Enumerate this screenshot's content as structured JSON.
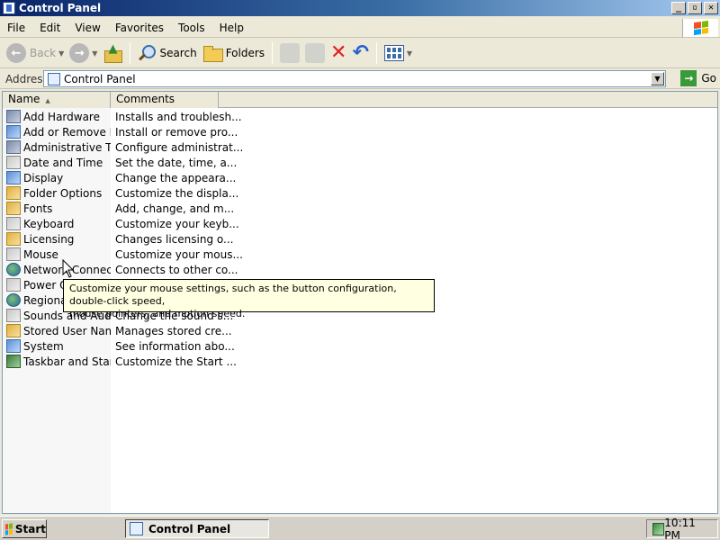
{
  "window": {
    "title": "Control Panel",
    "minimize": "_",
    "maximize": "▫",
    "close": "✕"
  },
  "menu": [
    "File",
    "Edit",
    "View",
    "Favorites",
    "Tools",
    "Help"
  ],
  "toolbar": {
    "back": "Back",
    "search": "Search",
    "folders": "Folders"
  },
  "address": {
    "label": "Address",
    "value": "Control Panel",
    "go": "Go"
  },
  "columns": {
    "name": "Name",
    "comments": "Comments"
  },
  "items": [
    {
      "name": "Add Hardware",
      "comment": "Installs and troublesh...",
      "icon": "add-hardware-icon"
    },
    {
      "name": "Add or Remove Pr...",
      "comment": "Install or remove pro...",
      "icon": "add-remove-programs-icon"
    },
    {
      "name": "Administrative Tools",
      "comment": "Configure administrat...",
      "icon": "administrative-tools-icon"
    },
    {
      "name": "Date and Time",
      "comment": "Set the date, time, a...",
      "icon": "date-time-icon"
    },
    {
      "name": "Display",
      "comment": "Change the appeara...",
      "icon": "display-icon"
    },
    {
      "name": "Folder Options",
      "comment": "Customize the displa...",
      "icon": "folder-options-icon"
    },
    {
      "name": "Fonts",
      "comment": "Add, change, and m...",
      "icon": "fonts-icon"
    },
    {
      "name": "Keyboard",
      "comment": "Customize your keyb...",
      "icon": "keyboard-icon"
    },
    {
      "name": "Licensing",
      "comment": "Changes licensing o...",
      "icon": "licensing-icon"
    },
    {
      "name": "Mouse",
      "comment": "Customize your mous...",
      "icon": "mouse-icon"
    },
    {
      "name": "Network Connecti...",
      "comment": "Connects to other co...",
      "icon": "network-connections-icon"
    },
    {
      "name": "Power Op...",
      "comment": "",
      "icon": "power-options-icon"
    },
    {
      "name": "Regional ...",
      "comment": "",
      "icon": "regional-options-icon"
    },
    {
      "name": "Sounds and Audio...",
      "comment": "Change the sound s...",
      "icon": "sounds-audio-icon"
    },
    {
      "name": "Stored User Name...",
      "comment": "Manages stored cre...",
      "icon": "stored-user-names-icon"
    },
    {
      "name": "System",
      "comment": "See information abo...",
      "icon": "system-icon"
    },
    {
      "name": "Taskbar and Start...",
      "comment": "Customize the Start ...",
      "icon": "taskbar-start-icon"
    }
  ],
  "tooltip": {
    "line1": "Customize your mouse settings, such as the button configuration, double-click speed,",
    "line2": "mouse pointers, and motion speed."
  },
  "taskbar": {
    "start": "Start",
    "task": "Control Panel",
    "clock": "10:11 PM"
  }
}
